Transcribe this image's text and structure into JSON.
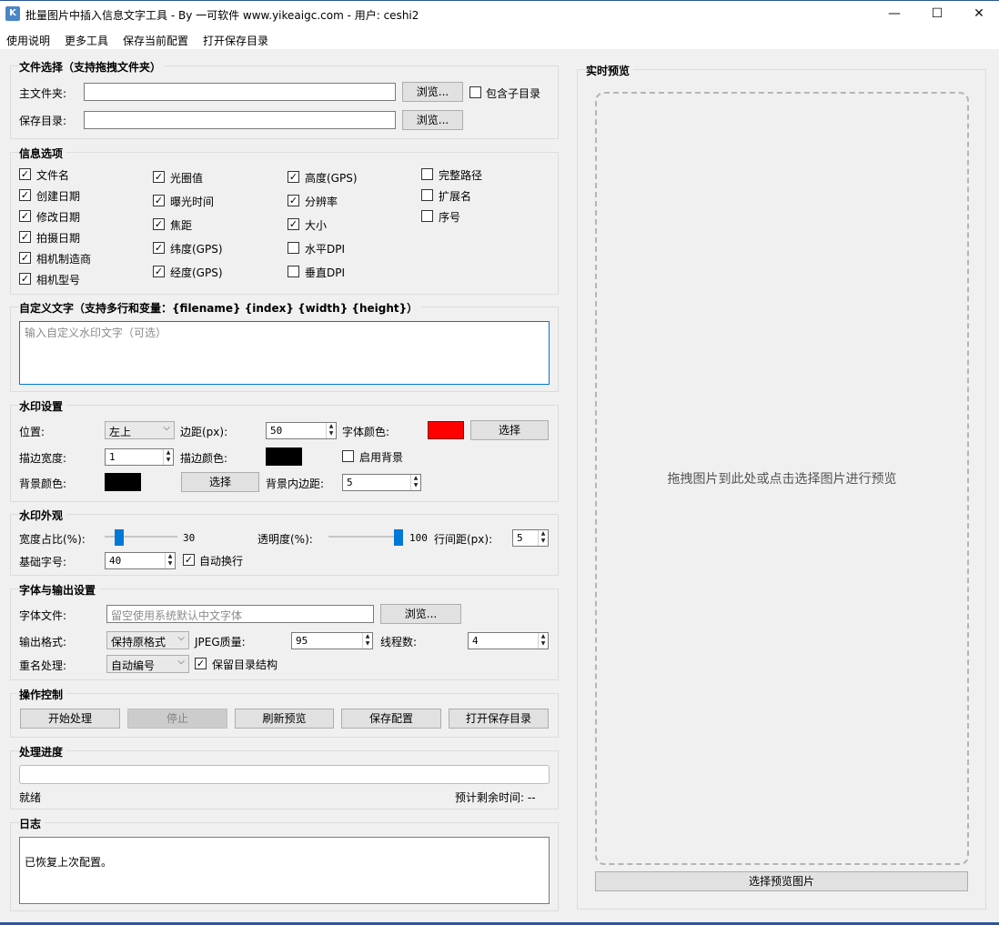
{
  "window": {
    "title": "批量图片中插入信息文字工具 - By 一可软件 www.yikeaigc.com - 用户: ceshi2",
    "minimize": "—",
    "maximize": "☐",
    "close": "✕"
  },
  "menu": [
    "使用说明",
    "更多工具",
    "保存当前配置",
    "打开保存目录"
  ],
  "file_select": {
    "title": "文件选择（支持拖拽文件夹）",
    "main_folder_label": "主文件夹:",
    "main_folder_value": "",
    "save_dir_label": "保存目录:",
    "save_dir_value": "",
    "browse": "浏览...",
    "include_sub": "包含子目录",
    "include_sub_checked": false
  },
  "info_options": {
    "title": "信息选项",
    "col1": [
      {
        "label": "文件名",
        "checked": true
      },
      {
        "label": "创建日期",
        "checked": true
      },
      {
        "label": "修改日期",
        "checked": true
      },
      {
        "label": "拍摄日期",
        "checked": true
      },
      {
        "label": "相机制造商",
        "checked": true
      },
      {
        "label": "相机型号",
        "checked": true
      }
    ],
    "col2": [
      {
        "label": "光圈值",
        "checked": true
      },
      {
        "label": "曝光时间",
        "checked": true
      },
      {
        "label": "焦距",
        "checked": true
      },
      {
        "label": "纬度(GPS)",
        "checked": true
      },
      {
        "label": "经度(GPS)",
        "checked": true
      }
    ],
    "col3": [
      {
        "label": "高度(GPS)",
        "checked": true
      },
      {
        "label": "分辨率",
        "checked": true
      },
      {
        "label": "大小",
        "checked": true
      },
      {
        "label": "水平DPI",
        "checked": false
      },
      {
        "label": "垂直DPI",
        "checked": false
      }
    ],
    "col4": [
      {
        "label": "完整路径",
        "checked": false
      },
      {
        "label": "扩展名",
        "checked": false
      },
      {
        "label": "序号",
        "checked": false
      }
    ]
  },
  "custom_text": {
    "title": "自定义文字（支持多行和变量：{filename} {index} {width} {height}）",
    "placeholder": "输入自定义水印文字（可选）"
  },
  "watermark": {
    "title": "水印设置",
    "position_label": "位置:",
    "position_value": "左上",
    "margin_label": "边距(px):",
    "margin_value": "50",
    "font_color_label": "字体颜色:",
    "font_color": "#ff0000",
    "select": "选择",
    "stroke_width_label": "描边宽度:",
    "stroke_width_value": "1",
    "stroke_color_label": "描边颜色:",
    "stroke_color": "#000000",
    "enable_bg": "启用背景",
    "enable_bg_checked": false,
    "bg_color_label": "背景颜色:",
    "bg_color": "#000000",
    "bg_padding_label": "背景内边距:",
    "bg_padding_value": "5"
  },
  "appearance": {
    "title": "水印外观",
    "width_ratio_label": "宽度占比(%):",
    "width_ratio_value": "30",
    "width_ratio_fraction": 0.3,
    "opacity_label": "透明度(%):",
    "opacity_value": "100",
    "opacity_fraction": 1.0,
    "line_spacing_label": "行间距(px):",
    "line_spacing_value": "5",
    "base_font_label": "基础字号:",
    "base_font_value": "40",
    "auto_wrap": "自动换行",
    "auto_wrap_checked": true
  },
  "font_output": {
    "title": "字体与输出设置",
    "font_file_label": "字体文件:",
    "font_file_placeholder": "留空使用系统默认中文字体",
    "browse": "浏览...",
    "format_label": "输出格式:",
    "format_value": "保持原格式",
    "jpeg_label": "JPEG质量:",
    "jpeg_value": "95",
    "threads_label": "线程数:",
    "threads_value": "4",
    "rename_label": "重名处理:",
    "rename_value": "自动编号",
    "keep_structure": "保留目录结构",
    "keep_structure_checked": true
  },
  "controls": {
    "title": "操作控制",
    "start": "开始处理",
    "stop": "停止",
    "refresh": "刷新预览",
    "save_config": "保存配置",
    "open_dir": "打开保存目录"
  },
  "progress": {
    "title": "处理进度",
    "value": 0,
    "status": "就绪",
    "eta": "预计剩余时间: --"
  },
  "log": {
    "title": "日志",
    "text": "已恢复上次配置。"
  },
  "preview": {
    "title": "实时预览",
    "hint": "拖拽图片到此处或点击选择图片进行预览",
    "button": "选择预览图片"
  },
  "colors": {
    "accent": "#0078d7",
    "focus_border": "#0078d7"
  }
}
